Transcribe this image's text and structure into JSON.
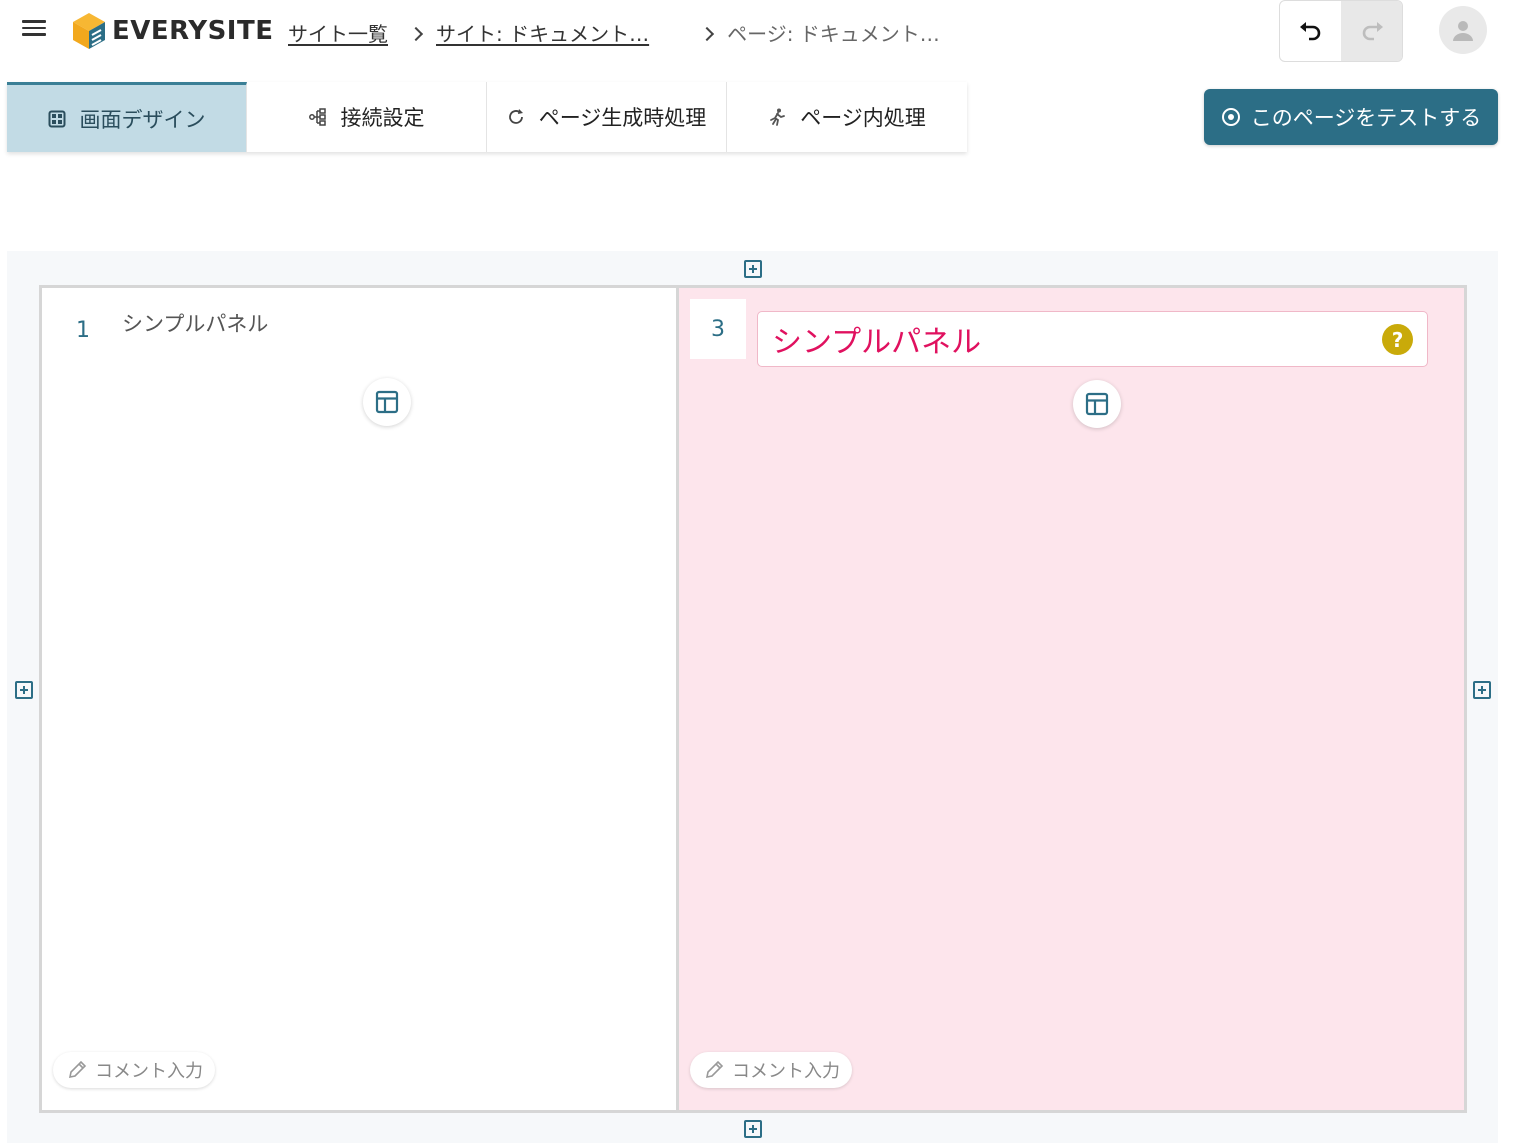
{
  "header": {
    "logo_text": "EVERYSITE",
    "breadcrumb": {
      "sites_link": "サイト一覧",
      "site_link": "サイト: ドキュメント…",
      "page_current": "ページ: ドキュメント…"
    }
  },
  "tabs": [
    {
      "label": "画面デザイン",
      "icon": "grid-icon",
      "active": true
    },
    {
      "label": "接続設定",
      "icon": "connection-icon",
      "active": false
    },
    {
      "label": "ページ生成時処理",
      "icon": "refresh-icon",
      "active": false
    },
    {
      "label": "ページ内処理",
      "icon": "runner-icon",
      "active": false
    }
  ],
  "test_button": {
    "label": "このページをテストする",
    "icon": "eye-icon"
  },
  "panels": {
    "left": {
      "number": "1",
      "title": "シンプルパネル",
      "comment_label": "コメント入力"
    },
    "right": {
      "number": "3",
      "title": "シンプルパネル",
      "comment_label": "コメント入力",
      "help_glyph": "?"
    }
  },
  "colors": {
    "accent": "#2c6e86",
    "active_tab_bg": "#c2dbe5",
    "selected_panel_bg": "#fde5ec",
    "title_text": "#e0115f",
    "help_icon": "#c9aa0a",
    "logo_orange": "#f2a81d"
  }
}
